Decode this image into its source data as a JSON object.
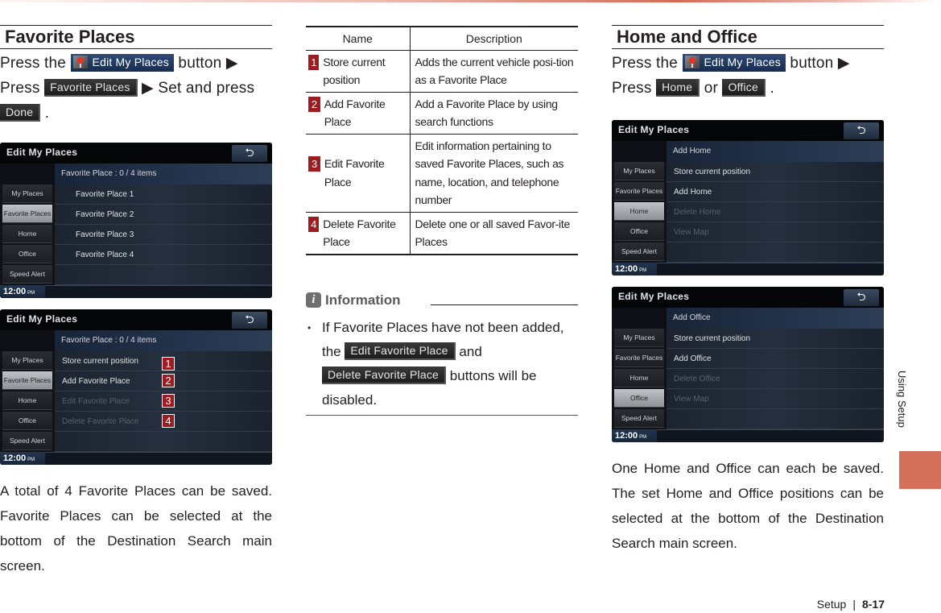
{
  "left": {
    "title": "Favorite Places",
    "instruction": {
      "press_the": "Press the",
      "edit_button": "Edit My Places",
      "button_word": "button ▶",
      "press": "Press",
      "favorite_button": "Favorite Places",
      "set_and_press": "▶ Set and press",
      "done_button": "Done",
      "period": "."
    },
    "screen1": {
      "title": "Edit My Places",
      "back_icon": "back-arrow-icon",
      "subheader": "Favorite Place : 0 / 4 items",
      "side_items": [
        "My Places",
        "Favorite Places",
        "Home",
        "Office",
        "Speed Alert"
      ],
      "active_side": "Favorite Places",
      "list": [
        "Favorite Place 1",
        "Favorite Place 2",
        "Favorite Place 3",
        "Favorite Place 4"
      ],
      "clock": "12:00",
      "ampm": "PM"
    },
    "screen2": {
      "title": "Edit My Places",
      "subheader": "Favorite Place : 0 / 4 items",
      "side_items": [
        "My Places",
        "Favorite Places",
        "Home",
        "Office",
        "Speed Alert"
      ],
      "list": [
        {
          "label": "Store current position",
          "enabled": true,
          "callout": "1"
        },
        {
          "label": "Add Favorite Place",
          "enabled": true,
          "callout": "2"
        },
        {
          "label": "Edit Favorite Place",
          "enabled": false,
          "callout": "3"
        },
        {
          "label": "Delete Favorite Place",
          "enabled": false,
          "callout": "4"
        }
      ],
      "clock": "12:00",
      "ampm": "PM"
    },
    "body": "A total of 4 Favorite Places can be saved. Favorite Places can be selected at the bottom of the Destination Search main screen."
  },
  "table": {
    "headers": [
      "Name",
      "Description"
    ],
    "rows": [
      {
        "num": "1",
        "name": "Store current position",
        "desc": "Adds the current vehicle posi-tion as a Favorite Place"
      },
      {
        "num": "2",
        "name": "Add Favorite Place",
        "desc": "Add a Favorite Place by using search functions"
      },
      {
        "num": "3",
        "name": "Edit Favorite Place",
        "desc": "Edit information pertaining to saved Favorite Places, such as name, location, and telephone number"
      },
      {
        "num": "4",
        "name": "Delete Favorite Place",
        "desc": "Delete one or all saved Favor-ite Places"
      }
    ]
  },
  "info": {
    "icon": "i",
    "label": "Information",
    "text_1": "If Favorite Places have not been added, the",
    "btn_edit": "Edit Favorite Place",
    "text_and": "and",
    "btn_delete": "Delete Favorite Place",
    "text_2": "buttons will be disabled."
  },
  "right": {
    "title": "Home and Office",
    "instruction": {
      "press_the": "Press the",
      "edit_button": "Edit My Places",
      "button_word": "button ▶",
      "press": "Press",
      "home_button": "Home",
      "or": "or",
      "office_button": "Office",
      "period": "."
    },
    "screen3": {
      "title": "Edit My Places",
      "subheader": "Add Home",
      "side_items": [
        "My Places",
        "Favorite Places",
        "Home",
        "Office",
        "Speed Alert"
      ],
      "active_side": "Home",
      "list": [
        {
          "label": "Store current position",
          "enabled": true
        },
        {
          "label": "Add Home",
          "enabled": true
        },
        {
          "label": "Delete Home",
          "enabled": false
        },
        {
          "label": "View Map",
          "enabled": false
        }
      ],
      "clock": "12:00",
      "ampm": "PM"
    },
    "screen4": {
      "title": "Edit My Places",
      "subheader": "Add Office",
      "side_items": [
        "My Places",
        "Favorite Places",
        "Home",
        "Office",
        "Speed Alert"
      ],
      "active_side": "Office",
      "list": [
        {
          "label": "Store current position",
          "enabled": true
        },
        {
          "label": "Add Office",
          "enabled": true
        },
        {
          "label": "Delete Office",
          "enabled": false
        },
        {
          "label": "View Map",
          "enabled": false
        }
      ],
      "clock": "12:00",
      "ampm": "PM"
    },
    "body": "One Home and Office can each be saved. The set Home and Office positions can be selected at the bottom of the Destination Search main screen."
  },
  "side_tab": {
    "label": "Using Setup",
    "color": "#d4705b"
  },
  "footer": {
    "section": "Setup",
    "separator": "|",
    "page": "8-17"
  },
  "colors": {
    "callout": "#9e1b1f",
    "accent": "#d66a56"
  }
}
